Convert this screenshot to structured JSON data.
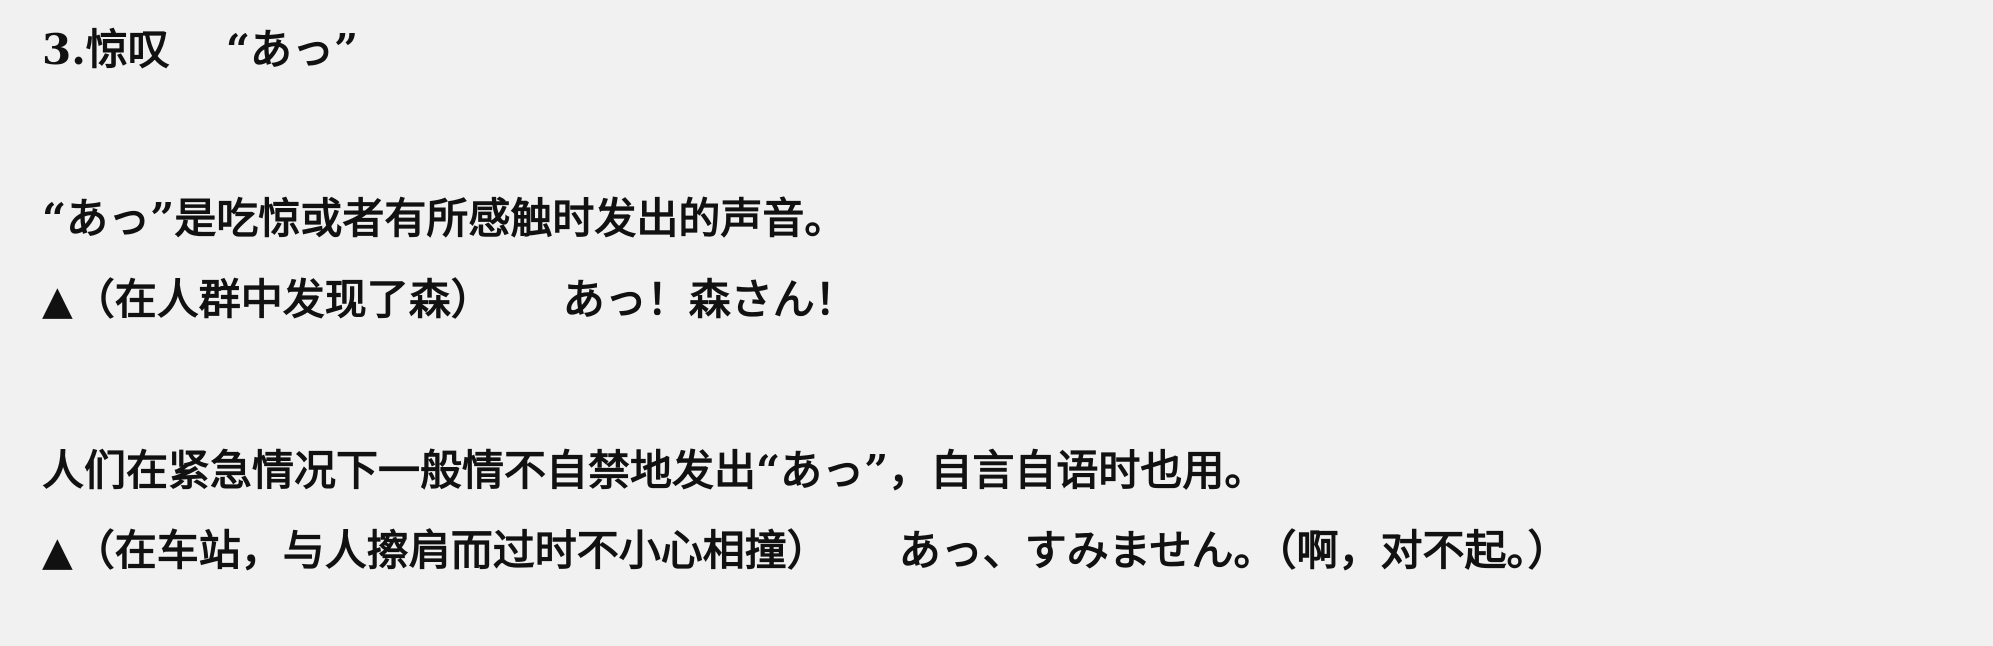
{
  "heading": {
    "number_title": "3.惊叹",
    "term": "“あっ”"
  },
  "section1": {
    "explanation": "“あっ”是吃惊或者有所感触时发出的声音。",
    "example": {
      "marker": "▲",
      "situation": "（在人群中发现了森）",
      "utterance": "あっ！森さん！"
    }
  },
  "section2": {
    "explanation": "人们在紧急情况下一般情不自禁地发出“あっ”，自言自语时也用。",
    "example": {
      "marker": "▲",
      "situation": "（在车站，与人擦肩而过时不小心相撞）",
      "utterance": "あっ、すみません。（啊，对不起。）"
    }
  }
}
